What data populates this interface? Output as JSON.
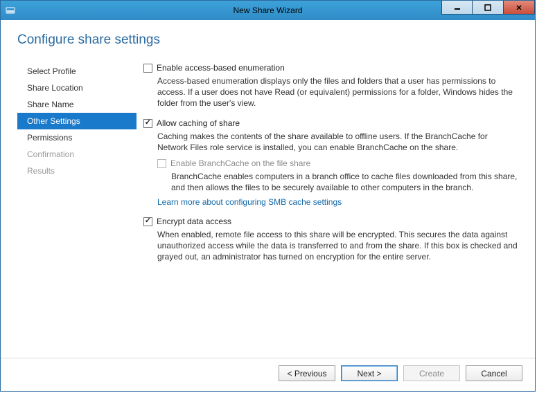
{
  "window": {
    "title": "New Share Wizard"
  },
  "page_title": "Configure share settings",
  "nav": {
    "items": [
      {
        "label": "Select Profile",
        "state": "normal"
      },
      {
        "label": "Share Location",
        "state": "normal"
      },
      {
        "label": "Share Name",
        "state": "normal"
      },
      {
        "label": "Other Settings",
        "state": "selected"
      },
      {
        "label": "Permissions",
        "state": "normal"
      },
      {
        "label": "Confirmation",
        "state": "disabled"
      },
      {
        "label": "Results",
        "state": "disabled"
      }
    ]
  },
  "options": {
    "enable_abe": {
      "label": "Enable access-based enumeration",
      "checked": false,
      "desc": "Access-based enumeration displays only the files and folders that a user has permissions to access. If a user does not have Read (or equivalent) permissions for a folder, Windows hides the folder from the user's view."
    },
    "allow_caching": {
      "label": "Allow caching of share",
      "checked": true,
      "desc": "Caching makes the contents of the share available to offline users. If the BranchCache for Network Files role service is installed, you can enable BranchCache on the share.",
      "sub": {
        "label": "Enable BranchCache on the file share",
        "checked": false,
        "disabled": true,
        "desc": "BranchCache enables computers in a branch office to cache files downloaded from this share, and then allows the files to be securely available to other computers in the branch."
      },
      "link": "Learn more about configuring SMB cache settings"
    },
    "encrypt": {
      "label": "Encrypt data access",
      "checked": true,
      "desc": "When enabled, remote file access to this share will be encrypted. This secures the data against unauthorized access while the data is transferred to and from the share. If this box is checked and grayed out, an administrator has turned on encryption for the entire server."
    }
  },
  "footer": {
    "previous": "< Previous",
    "next": "Next >",
    "create": "Create",
    "cancel": "Cancel"
  }
}
